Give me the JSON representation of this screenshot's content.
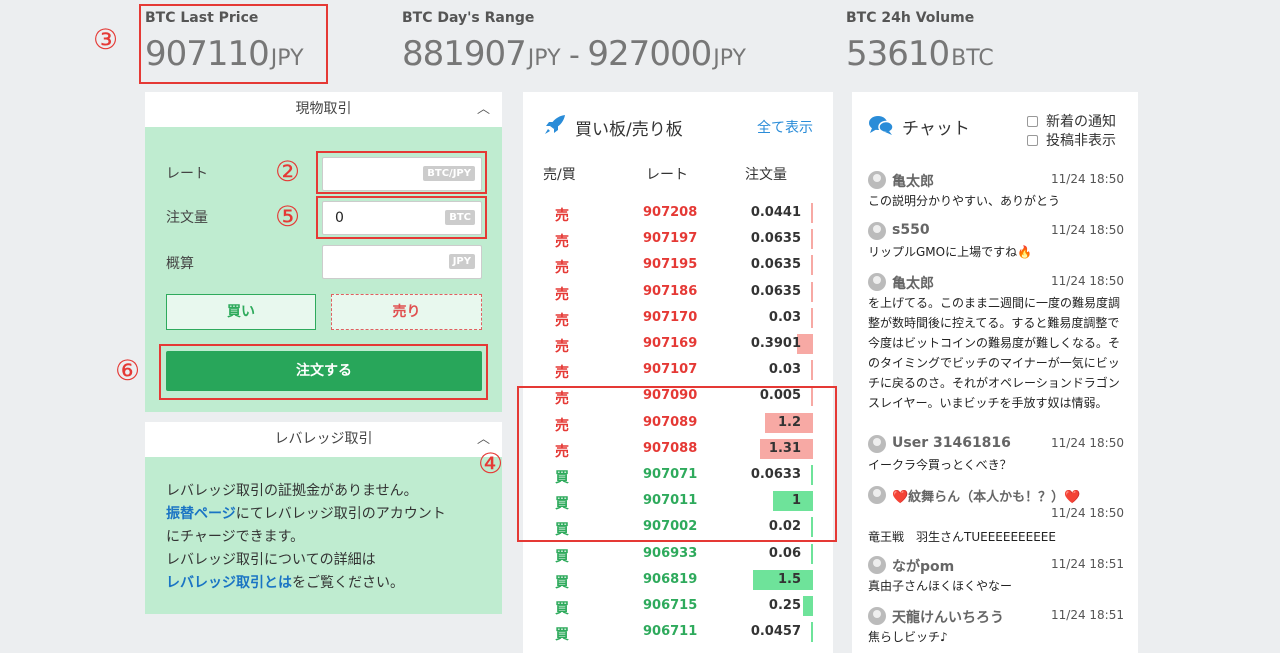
{
  "stats": {
    "last_price": {
      "label": "BTC Last Price",
      "value": "907110",
      "unit": "JPY"
    },
    "day_range": {
      "label": "BTC Day's Range",
      "low": "881907",
      "low_unit": "JPY",
      "sep": " - ",
      "high": "927000",
      "high_unit": "JPY"
    },
    "volume": {
      "label": "BTC 24h Volume",
      "value": "53610",
      "unit": "BTC"
    }
  },
  "annotations": {
    "n2": "②",
    "n3": "③",
    "n4": "④",
    "n5": "⑤",
    "n6": "⑥"
  },
  "spot": {
    "title": "現物取引",
    "rate_label": "レート",
    "rate_value": "",
    "rate_tag": "BTC/JPY",
    "amount_label": "注文量",
    "amount_value": "0",
    "amount_tag": "BTC",
    "estimate_label": "概算",
    "estimate_value": "",
    "estimate_tag": "JPY",
    "buy_label": "買い",
    "sell_label": "売り",
    "order_label": "注文する"
  },
  "leverage": {
    "title": "レバレッジ取引",
    "line1": "レバレッジ取引の証拠金がありません。",
    "link1": "振替ページ",
    "line2": "にてレバレッジ取引のアカウント",
    "line3": "にチャージできます。",
    "line4": "レバレッジ取引についての詳細は",
    "link2": "レバレッジ取引とは",
    "line5": "をご覧ください。"
  },
  "orderbook": {
    "title": "買い板/売り板",
    "show_all": "全て表示",
    "col_side": "売/買",
    "col_rate": "レート",
    "col_amount": "注文量",
    "rows": [
      {
        "side": "売",
        "type": "sell",
        "rate": "907208",
        "amount": "0.0441",
        "depth": 0.02
      },
      {
        "side": "売",
        "type": "sell",
        "rate": "907197",
        "amount": "0.0635",
        "depth": 0.03
      },
      {
        "side": "売",
        "type": "sell",
        "rate": "907195",
        "amount": "0.0635",
        "depth": 0.03
      },
      {
        "side": "売",
        "type": "sell",
        "rate": "907186",
        "amount": "0.0635",
        "depth": 0.03
      },
      {
        "side": "売",
        "type": "sell",
        "rate": "907170",
        "amount": "0.03",
        "depth": 0.015
      },
      {
        "side": "売",
        "type": "sell",
        "rate": "907169",
        "amount": "0.3901",
        "depth": 0.2
      },
      {
        "side": "売",
        "type": "sell",
        "rate": "907107",
        "amount": "0.03",
        "depth": 0.015
      },
      {
        "side": "売",
        "type": "sell",
        "rate": "907090",
        "amount": "0.005",
        "depth": 0.0
      },
      {
        "side": "売",
        "type": "sell",
        "rate": "907089",
        "amount": "1.2",
        "depth": 0.6
      },
      {
        "side": "売",
        "type": "sell",
        "rate": "907088",
        "amount": "1.31",
        "depth": 0.66
      },
      {
        "side": "買",
        "type": "buy",
        "rate": "907071",
        "amount": "0.0633",
        "depth": 0.03
      },
      {
        "side": "買",
        "type": "buy",
        "rate": "907011",
        "amount": "1",
        "depth": 0.5
      },
      {
        "side": "買",
        "type": "buy",
        "rate": "907002",
        "amount": "0.02",
        "depth": 0.01
      },
      {
        "side": "買",
        "type": "buy",
        "rate": "906933",
        "amount": "0.06",
        "depth": 0.03
      },
      {
        "side": "買",
        "type": "buy",
        "rate": "906819",
        "amount": "1.5",
        "depth": 0.75
      },
      {
        "side": "買",
        "type": "buy",
        "rate": "906715",
        "amount": "0.25",
        "depth": 0.13
      },
      {
        "side": "買",
        "type": "buy",
        "rate": "906711",
        "amount": "0.0457",
        "depth": 0.02
      }
    ]
  },
  "chat": {
    "title": "チャット",
    "opt_notify": "新着の通知",
    "opt_hide": "投稿非表示",
    "messages": [
      {
        "name": "亀太郎",
        "time": "11/24 18:50",
        "text": "この説明分かりやすい、ありがとう"
      },
      {
        "name": "s550",
        "time": "11/24 18:50",
        "text": "リップルGMOに上場ですね🔥"
      },
      {
        "name": "亀太郎",
        "time": "11/24 18:50",
        "text": "を上げてる。このまま二週間に一度の難易度調整が数時間後に控えてる。すると難易度調整で今度はビットコインの難易度が難しくなる。そのタイミングでビッチのマイナーが一気にビッチに戻るのさ。それがオペレーションドラゴンスレイヤー。いまビッチを手放す奴は情弱。"
      },
      {
        "name": "User 31461816",
        "time": "11/24 18:50",
        "text": "イークラ今買っとくべき？"
      },
      {
        "name": "❤️紋舞らん（本人かも！？）❤️",
        "time": "11/24 18:50",
        "text": "竜王戦　羽生さんTUEEEEEEEEEE"
      },
      {
        "name": "ながpom",
        "time": "11/24 18:51",
        "text": "真由子さんほくほくやなー"
      },
      {
        "name": "天龍けんいちろう",
        "time": "11/24 18:51",
        "text": "焦らしビッチ♪"
      }
    ]
  },
  "colors": {
    "sell": "#e53935",
    "buy": "#2eaa5c",
    "sell_bar": "#f7a9a4",
    "buy_bar": "#6ee39a",
    "panel_green": "#bfecd0"
  }
}
